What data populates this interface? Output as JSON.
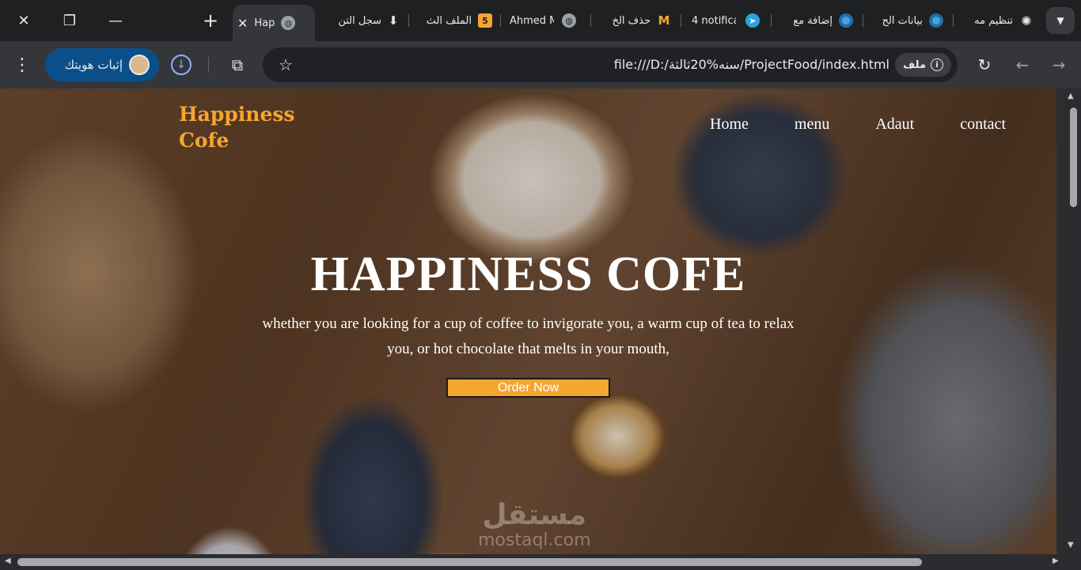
{
  "tabs": [
    {
      "title": "تنظيم مه",
      "icon": "openai-icon"
    },
    {
      "title": "بيانات الح",
      "icon": "circle-icon"
    },
    {
      "title": "إضافة مع",
      "icon": "circle-icon"
    },
    {
      "title": "4 notifica",
      "icon": "telegram-icon"
    },
    {
      "title": "حذف الخ",
      "icon": "gmail-icon"
    },
    {
      "title": "Ahmed M",
      "icon": "globe-icon"
    },
    {
      "title": "الملف الث",
      "icon": "five-icon",
      "badge": "5"
    },
    {
      "title": "سجل التن",
      "icon": "download-icon"
    },
    {
      "title": "Hap",
      "icon": "globe-icon",
      "active": true
    }
  ],
  "toolbar": {
    "url": "file:///D:/سنه%20ثالثة/ProjectFood/index.html",
    "site_chip": "ملف",
    "profile_label": "إثبات هويتك"
  },
  "site": {
    "logo_line1": "Happiness",
    "logo_line2": "Cofe",
    "nav": [
      "Home",
      "menu",
      "Adaut",
      "contact"
    ],
    "hero_title": "HAPPINESS COFE",
    "hero_text": "whether you are looking for a cup of coffee to invigorate you, a warm cup of tea to relax you, or hot chocolate that melts in your mouth,",
    "order_label": "Order Now"
  },
  "watermark": {
    "arabic": "مستقل",
    "latin": "mostaql.com"
  },
  "colors": {
    "accent": "#f6a531",
    "chrome_bg": "#1f2022",
    "toolbar_bg": "#35363a",
    "profile_btn": "#0b4f8a"
  }
}
